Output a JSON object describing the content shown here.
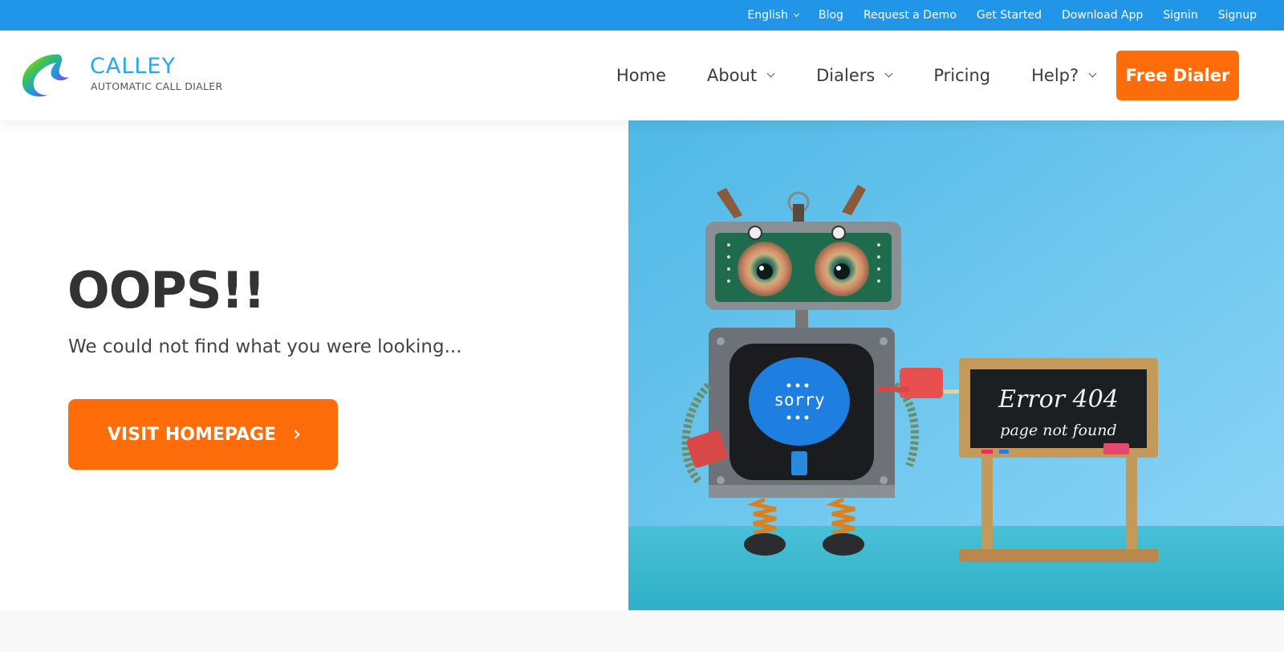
{
  "topbar": {
    "links": [
      {
        "label": "English",
        "has_dropdown": true
      },
      {
        "label": "Blog"
      },
      {
        "label": "Request a Demo"
      },
      {
        "label": "Get Started"
      },
      {
        "label": "Download App"
      },
      {
        "label": "Signin"
      },
      {
        "label": "Signup"
      }
    ]
  },
  "logo": {
    "name": "CALLEY",
    "tagline": "AUTOMATIC CALL DIALER"
  },
  "nav": {
    "items": [
      {
        "label": "Home",
        "has_dropdown": false
      },
      {
        "label": "About",
        "has_dropdown": true
      },
      {
        "label": "Dialers",
        "has_dropdown": true
      },
      {
        "label": "Pricing",
        "has_dropdown": false
      },
      {
        "label": "Help?",
        "has_dropdown": true
      }
    ],
    "cta_label": "Free Dialer"
  },
  "hero": {
    "headline": "OOPS!!",
    "subline": "We could not find what you were looking...",
    "button_label": "VISIT HOMEPAGE"
  },
  "illustration": {
    "screen_text": "sorry",
    "board_line1": "Error 404",
    "board_line2": "page not found"
  },
  "colors": {
    "topbar": "#2196e8",
    "accent": "#ff6c0a",
    "logo_blue": "#29a8e8",
    "sky": "#5cc4ef"
  }
}
